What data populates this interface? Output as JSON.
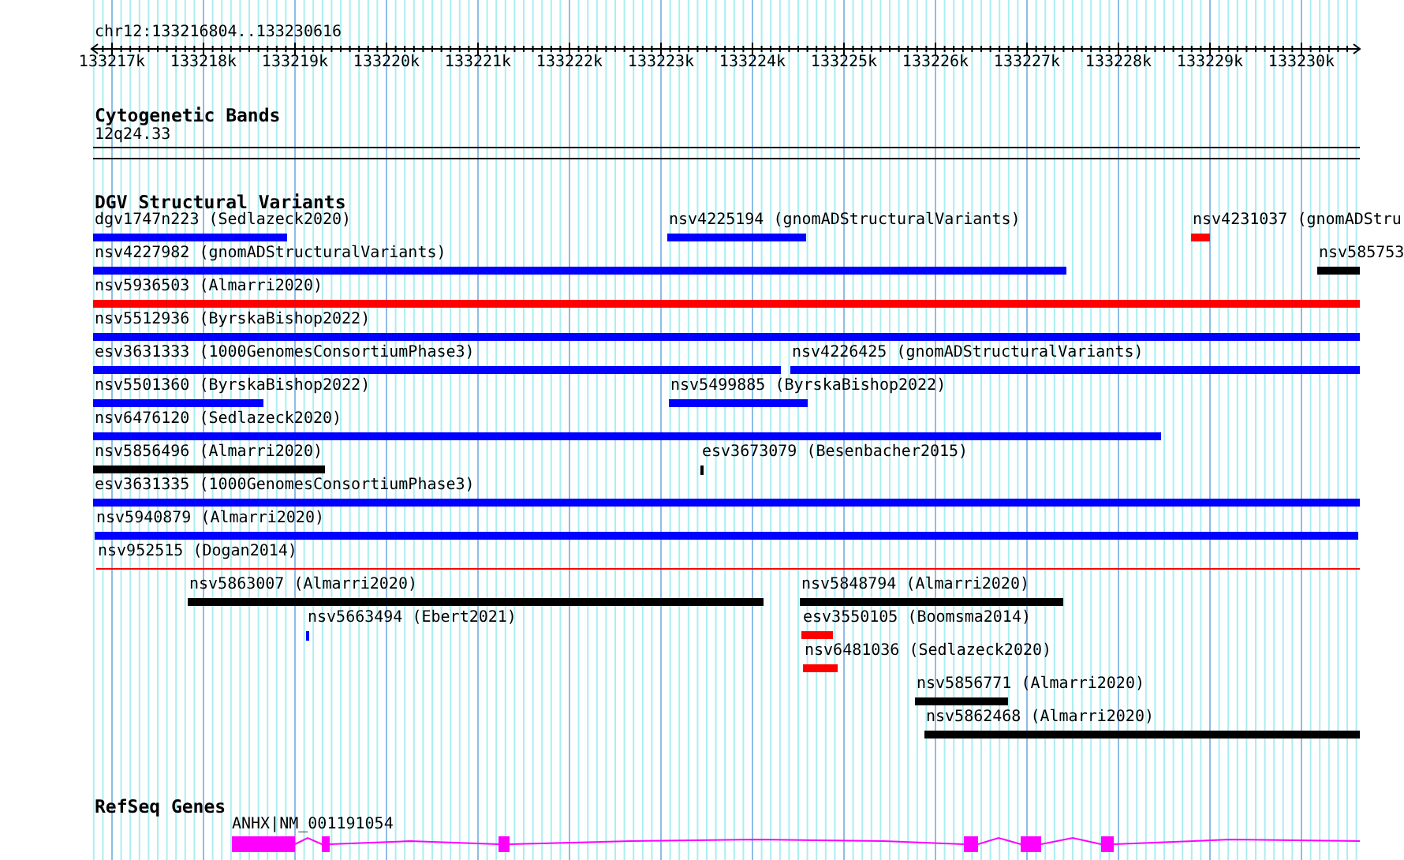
{
  "location": "chr12:133216804..133230616",
  "ruler": {
    "ticks": [
      "133217k",
      "133218k",
      "133219k",
      "133220k",
      "133221k",
      "133222k",
      "133223k",
      "133224k",
      "133225k",
      "133226k",
      "133227k",
      "133228k",
      "133229k",
      "133230k"
    ]
  },
  "tracks": [
    {
      "kind": "cytoband",
      "title": "Cytogenetic Bands",
      "bands": [
        "12q24.33"
      ]
    },
    {
      "kind": "variants",
      "title": "DGV Structural Variants",
      "features": [
        {
          "label": "dgv1747n223 (Sedlazeck2020)",
          "color": "#0000ff"
        },
        {
          "label": "nsv4225194 (gnomADStructuralVariants)",
          "color": "#0000ff"
        },
        {
          "label": "nsv4231037 (gnomADStru",
          "color": "#ff0000"
        },
        {
          "label": "nsv4227982 (gnomADStructuralVariants)",
          "color": "#0000ff"
        },
        {
          "label": "nsv585753",
          "color": "#000000"
        },
        {
          "label": "nsv5936503 (Almarri2020)",
          "color": "#ff0000"
        },
        {
          "label": "nsv5512936 (ByrskaBishop2022)",
          "color": "#0000ff"
        },
        {
          "label": "esv3631333 (1000GenomesConsortiumPhase3)",
          "color": "#0000ff"
        },
        {
          "label": "nsv4226425 (gnomADStructuralVariants)",
          "color": "#0000ff"
        },
        {
          "label": "nsv5501360 (ByrskaBishop2022)",
          "color": "#0000ff"
        },
        {
          "label": "nsv5499885 (ByrskaBishop2022)",
          "color": "#0000ff"
        },
        {
          "label": "nsv6476120 (Sedlazeck2020)",
          "color": "#0000ff"
        },
        {
          "label": "nsv5856496 (Almarri2020)",
          "color": "#000000"
        },
        {
          "label": "esv3673079 (Besenbacher2015)",
          "color": "#000000"
        },
        {
          "label": "esv3631335 (1000GenomesConsortiumPhase3)",
          "color": "#0000ff"
        },
        {
          "label": "nsv5940879 (Almarri2020)",
          "color": "#0000ff"
        },
        {
          "label": "nsv952515 (Dogan2014)",
          "color": "#ff0000"
        },
        {
          "label": "nsv5863007 (Almarri2020)",
          "color": "#000000"
        },
        {
          "label": "nsv5848794 (Almarri2020)",
          "color": "#000000"
        },
        {
          "label": "nsv5663494 (Ebert2021)",
          "color": "#0000ff"
        },
        {
          "label": "esv3550105 (Boomsma2014)",
          "color": "#ff0000"
        },
        {
          "label": "nsv6481036 (Sedlazeck2020)",
          "color": "#ff0000"
        },
        {
          "label": "nsv5856771 (Almarri2020)",
          "color": "#000000"
        },
        {
          "label": "nsv5862468 (Almarri2020)",
          "color": "#000000"
        }
      ]
    },
    {
      "kind": "genes",
      "title": "RefSeq Genes",
      "genes": [
        {
          "label": "ANHX|NM_001191054",
          "color": "#ff00ff"
        }
      ]
    }
  ]
}
